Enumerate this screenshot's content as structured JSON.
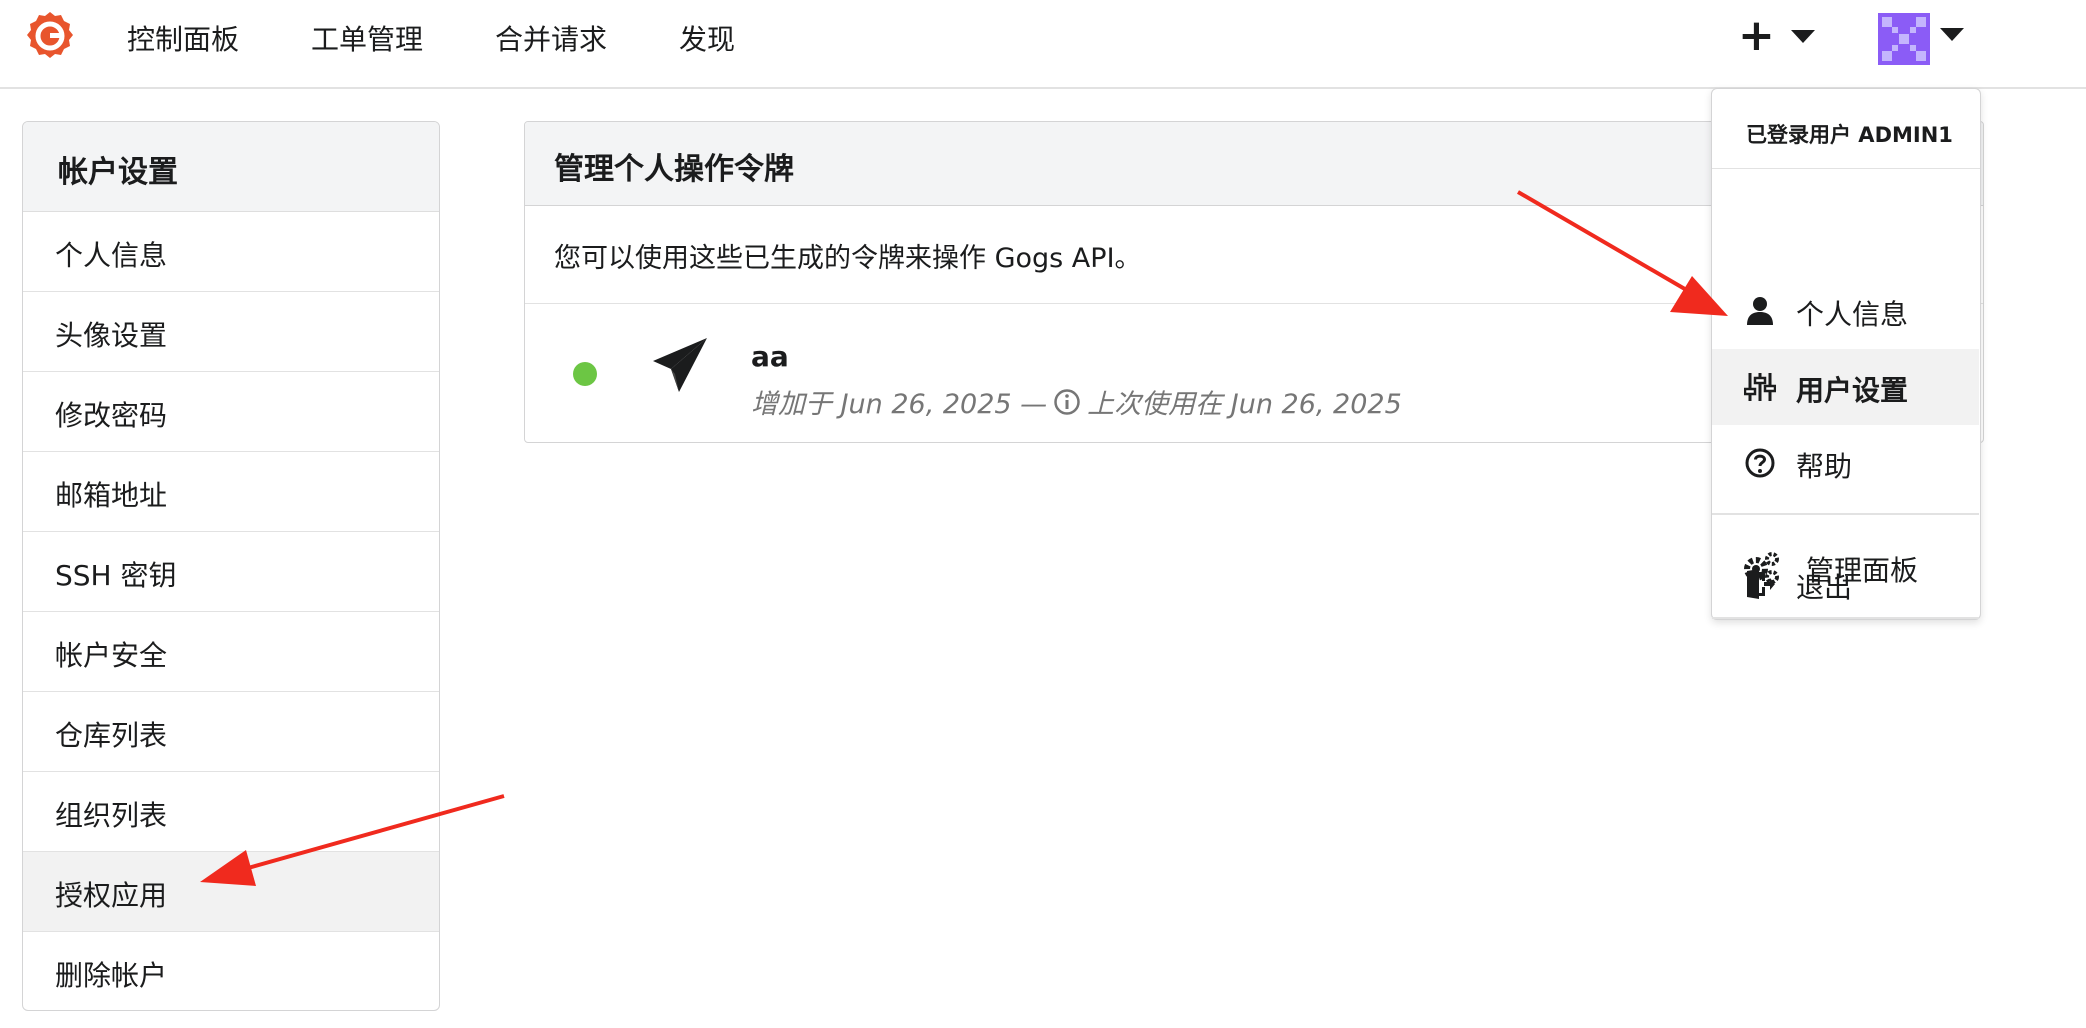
{
  "nav": {
    "items": [
      "控制面板",
      "工单管理",
      "合并请求",
      "发现"
    ],
    "plus_label": "+"
  },
  "sidebar": {
    "title": "帐户设置",
    "items": [
      "个人信息",
      "头像设置",
      "修改密码",
      "邮箱地址",
      "SSH 密钥",
      "帐户安全",
      "仓库列表",
      "组织列表",
      "授权应用",
      "删除帐户"
    ],
    "active_index": 8
  },
  "panel": {
    "title": "管理个人操作令牌",
    "description": "您可以使用这些已生成的令牌来操作 Gogs API。",
    "token": {
      "name": "aa",
      "added": "增加于 Jun 26, 2025 —",
      "last_used": "上次使用在 Jun 26, 2025",
      "status_color": "#6cc644"
    }
  },
  "dropdown": {
    "header": "已登录用户 ADMIN1",
    "items": [
      {
        "label": "个人信息",
        "icon": "user-icon"
      },
      {
        "label": "用户设置",
        "icon": "sliders-icon"
      },
      {
        "label": "帮助",
        "icon": "help-circle-icon"
      },
      {
        "label": "管理面板",
        "icon": "cogs-icon"
      },
      {
        "label": "退出",
        "icon": "sign-out-icon"
      }
    ],
    "active_index": 1
  },
  "colors": {
    "brand": "#e8552d",
    "annotation_arrow": "#f02a1e",
    "avatar": "#8b5cf6"
  }
}
